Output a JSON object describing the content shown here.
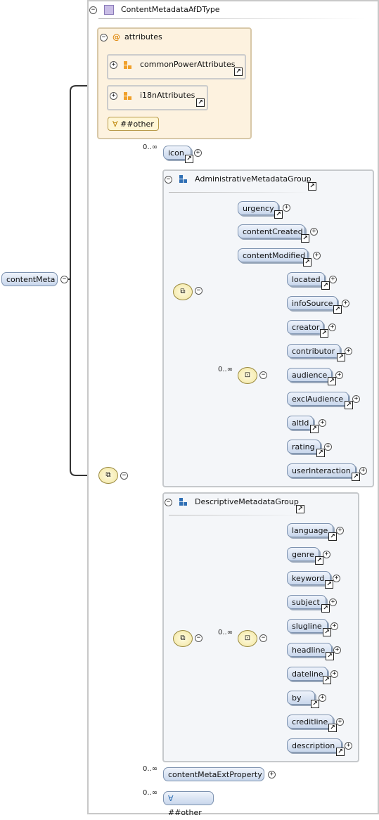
{
  "root": {
    "name": "contentMeta",
    "type": "ContentMetadataAfDType"
  },
  "attributes": {
    "label": "attributes",
    "groups": [
      "commonPowerAttributes",
      "i18nAttributes"
    ],
    "wildcard": "##other"
  },
  "occurrence": "0..∞",
  "icon": "icon",
  "admin_group": {
    "name": "AdministrativeMetadataGroup",
    "seq_items": [
      "urgency",
      "contentCreated",
      "contentModified"
    ],
    "choice_items": [
      "located",
      "infoSource",
      "creator",
      "contributor",
      "audience",
      "exclAudience",
      "altId",
      "rating",
      "userInteraction"
    ]
  },
  "desc_group": {
    "name": "DescriptiveMetadataGroup",
    "choice_items": [
      "language",
      "genre",
      "keyword",
      "subject",
      "slugline",
      "headline",
      "dateline",
      "by",
      "creditline",
      "description"
    ]
  },
  "ext_property": "contentMetaExtProperty",
  "other_wildcard": "##other",
  "symbols": {
    "plus": "+",
    "minus": "−",
    "ref_arrow": "↗",
    "wildcard": "∀",
    "at": "@"
  },
  "colors": {
    "element_fill": "#c9d7ec",
    "group_icon": "#2f6fb4",
    "attribute_icon": "#f0a02a",
    "attribute_bg": "#fdf2df"
  }
}
